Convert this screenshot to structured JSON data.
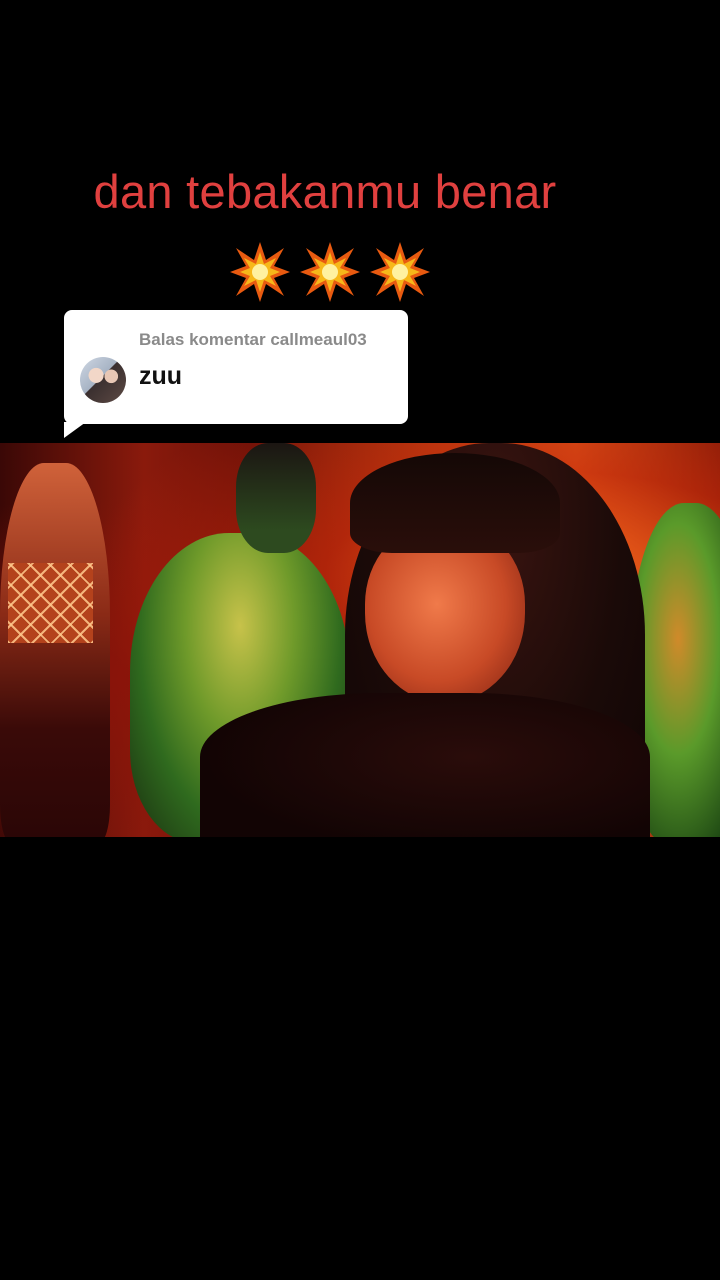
{
  "caption": {
    "text": "dan tebakanmu benar",
    "emojis": [
      "💥",
      "💥",
      "💥"
    ],
    "color": "#e0403f"
  },
  "reply_card": {
    "header": "Balas komentar callmeaul03",
    "comment": "zuu",
    "avatar_icon": "user-avatar"
  },
  "video": {
    "description_icon": "video-frame"
  }
}
